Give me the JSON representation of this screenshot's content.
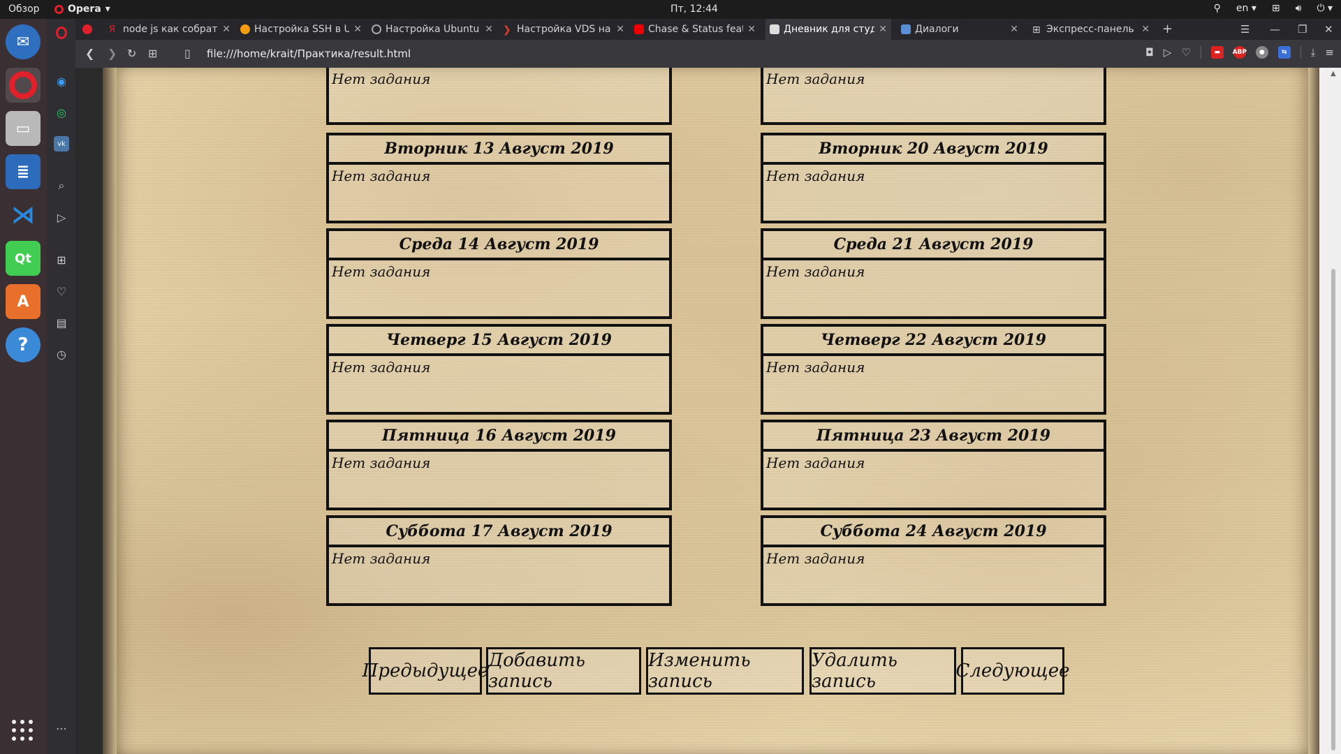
{
  "system": {
    "overview": "Обзор",
    "app_name": "Opera",
    "clock": "Пт, 12:44",
    "lang": "en"
  },
  "tabs": [
    {
      "label": "node js как собрать",
      "active": false
    },
    {
      "label": "Настройка SSH в Ub",
      "active": false
    },
    {
      "label": "Настройка Ubuntu",
      "active": false
    },
    {
      "label": "Настройка VDS на",
      "active": false
    },
    {
      "label": "Chase & Status feat",
      "active": false
    },
    {
      "label": "Дневник для студе",
      "active": true
    },
    {
      "label": "Диалоги",
      "active": false
    },
    {
      "label": "Экспресс-панель",
      "active": false
    }
  ],
  "address": {
    "url": "file:///home/krait/Практика/result.html"
  },
  "diary": {
    "empty_text": "Нет задания",
    "top_partial": [
      {
        "task": "Нет задания"
      },
      {
        "task": "Нет задания"
      }
    ],
    "left": [
      {
        "date": "Вторник 13 Август 2019",
        "task": "Нет задания"
      },
      {
        "date": "Среда 14 Август 2019",
        "task": "Нет задания"
      },
      {
        "date": "Четверг 15 Август 2019",
        "task": "Нет задания"
      },
      {
        "date": "Пятница 16 Август 2019",
        "task": "Нет задания"
      },
      {
        "date": "Суббота 17 Август 2019",
        "task": "Нет задания"
      }
    ],
    "right": [
      {
        "date": "Вторник 20 Август 2019",
        "task": "Нет задания"
      },
      {
        "date": "Среда 21 Август 2019",
        "task": "Нет задания"
      },
      {
        "date": "Четверг 22 Август 2019",
        "task": "Нет задания"
      },
      {
        "date": "Пятница 23 Август 2019",
        "task": "Нет задания"
      },
      {
        "date": "Суббота 24 Август 2019",
        "task": "Нет задания"
      }
    ]
  },
  "buttons": {
    "prev": "Предыдущее",
    "add": "Добавить запись",
    "edit": "Изменить запись",
    "delete": "Удалить запись",
    "next": "Следующее"
  },
  "colors": {
    "accent": "#e0202a",
    "ink": "#111111",
    "parchment": "#ead9b0"
  }
}
